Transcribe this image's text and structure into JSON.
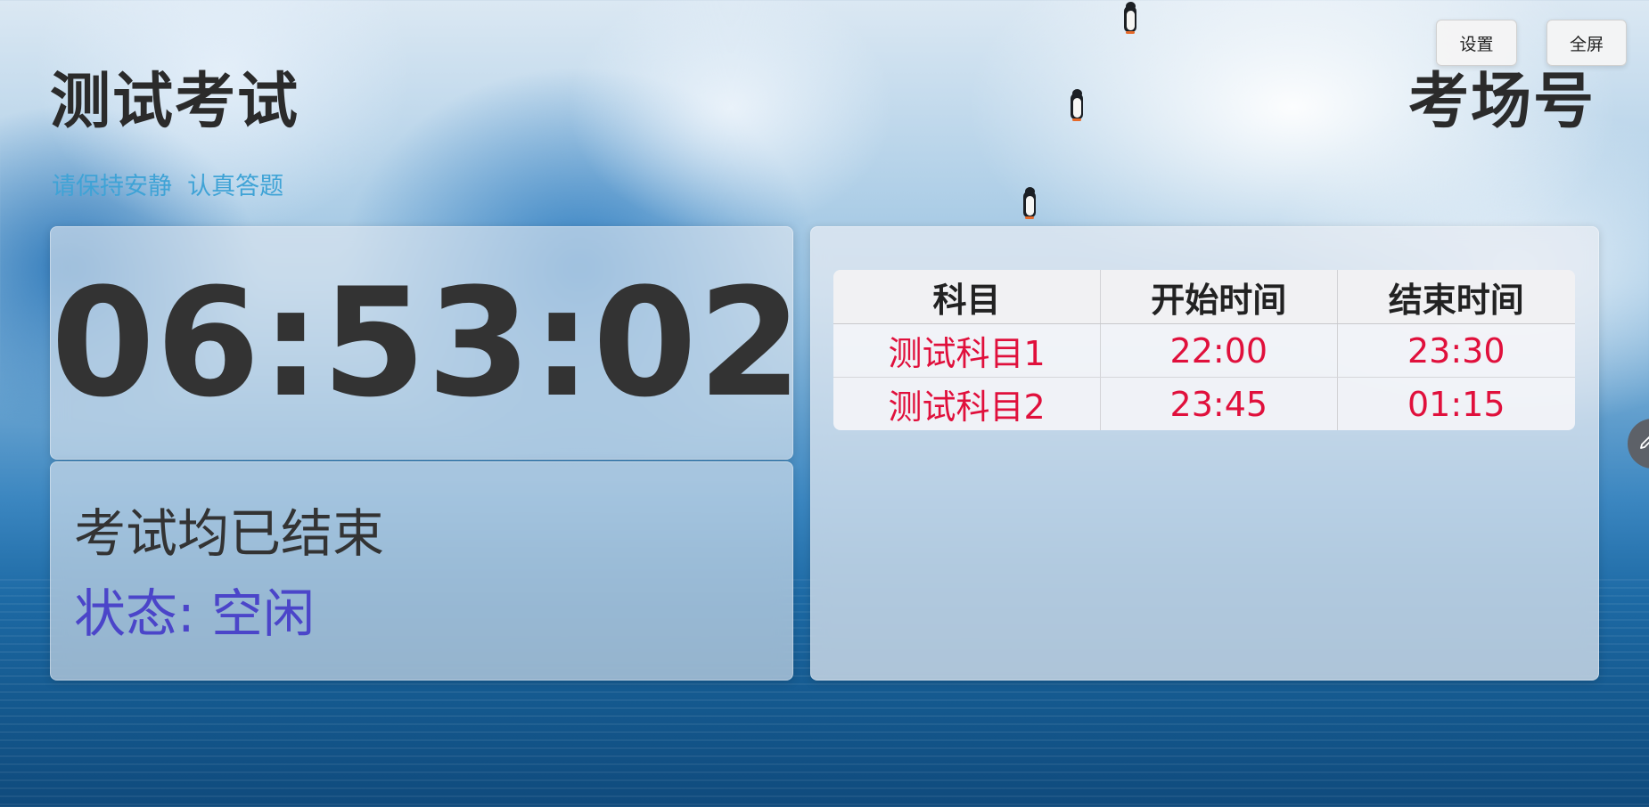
{
  "header": {
    "exam_title": "测试考试",
    "room_title": "考场号",
    "notice": "请保持安静  认真答题"
  },
  "toolbar": {
    "settings_label": "设置",
    "fullscreen_label": "全屏"
  },
  "clock": {
    "time": "06:53:02"
  },
  "status": {
    "message": "考试均已结束",
    "state_text": "状态: 空闲"
  },
  "schedule": {
    "headers": [
      "科目",
      "开始时间",
      "结束时间"
    ],
    "rows": [
      {
        "subject": "测试科目1",
        "start": "22:00",
        "end": "23:30"
      },
      {
        "subject": "测试科目2",
        "start": "23:45",
        "end": "01:15"
      }
    ]
  },
  "icons": {
    "edit": "pencil-icon"
  },
  "colors": {
    "notice": "#3fa3d6",
    "status_state": "#4b45c9",
    "schedule_values": "#e0103c"
  }
}
